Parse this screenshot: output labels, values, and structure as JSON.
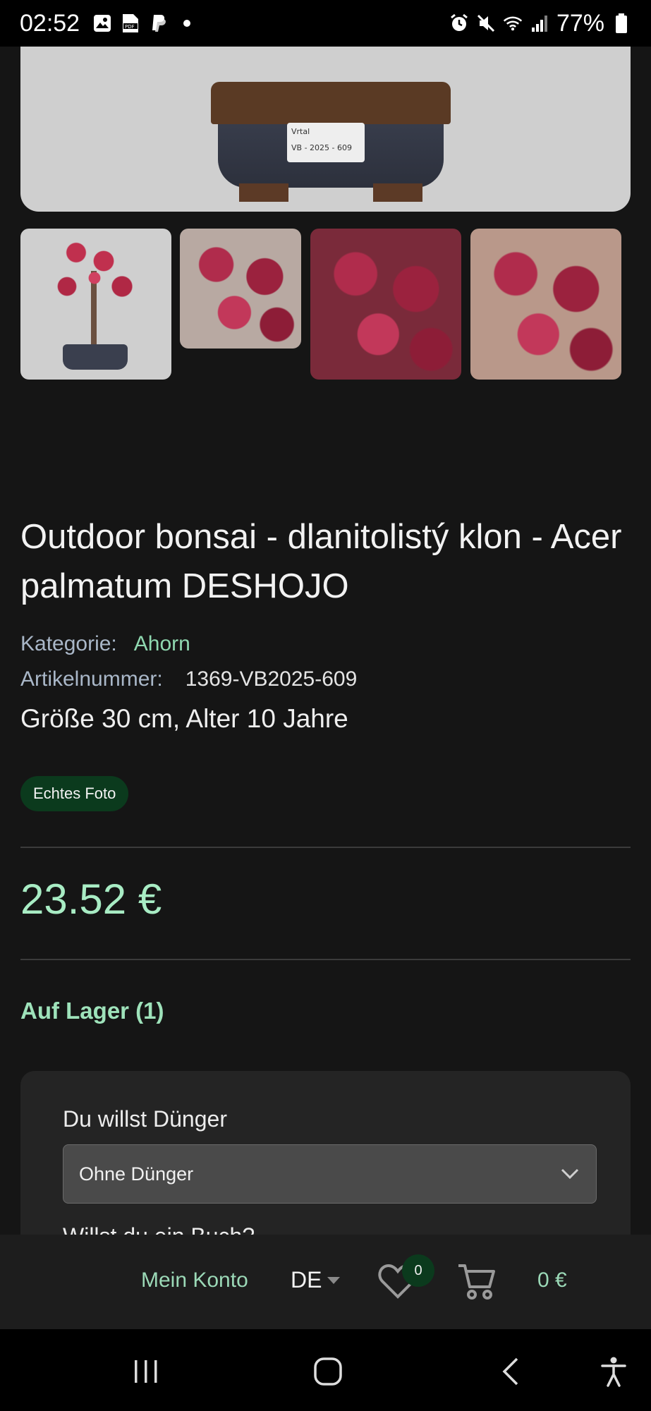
{
  "status_bar": {
    "time": "02:52",
    "battery": "77%",
    "icons": [
      "image-icon",
      "pdf-icon",
      "paypal-icon",
      "dot-icon",
      "alarm-icon",
      "mute-icon",
      "wifi-icon",
      "signal-icon",
      "battery-icon"
    ]
  },
  "gallery": {
    "label_text_top": "Vrtal",
    "label_text_bottom": "VB - 2025 - 609",
    "thumbnails": [
      "thumbnail-1",
      "thumbnail-2",
      "thumbnail-3",
      "thumbnail-4"
    ]
  },
  "product": {
    "title": "Outdoor bonsai - dlanitolistý klon - Acer palmatum DESHOJO",
    "category_label": "Kategorie:",
    "category_value": "Ahorn",
    "article_label": "Artikelnummer:",
    "article_value": "1369-VB2025-609",
    "size_line": "Größe 30 cm, Alter 10 Jahre",
    "badge": "Echtes Foto",
    "price": "23.52 €",
    "stock": "Auf Lager (1)"
  },
  "options": {
    "fertilizer_label": "Du willst Dünger",
    "fertilizer_selected": "Ohne Dünger",
    "book_label": "Willst du ein Buch?"
  },
  "site_bar": {
    "account": "Mein Konto",
    "language": "DE",
    "wishlist_count": "0",
    "cart_total": "0 €"
  },
  "colors": {
    "accent_green": "#9bd9b7",
    "price_green": "#a8ecc4",
    "badge_bg": "#0b3a1d",
    "background": "#151515"
  }
}
